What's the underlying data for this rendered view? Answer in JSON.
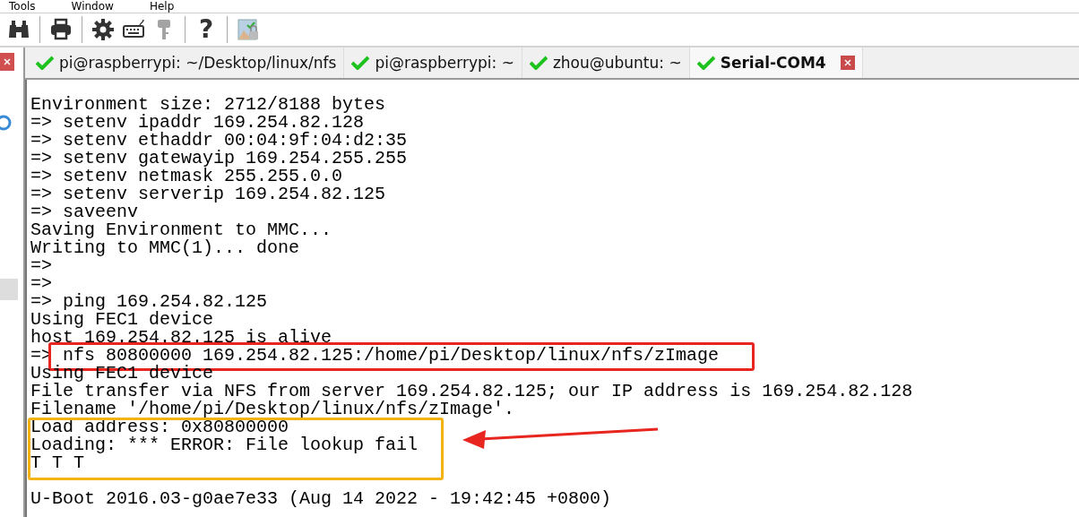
{
  "menu": [
    "Tools",
    "Window",
    "Help"
  ],
  "toolbar": [
    {
      "kind": "binoculars",
      "disabled": false
    },
    {
      "kind": "sep"
    },
    {
      "kind": "printer",
      "disabled": false
    },
    {
      "kind": "sep"
    },
    {
      "kind": "gear",
      "disabled": false
    },
    {
      "kind": "keyboard",
      "disabled": false
    },
    {
      "kind": "key",
      "disabled": true
    },
    {
      "kind": "sep"
    },
    {
      "kind": "help",
      "label": "?",
      "disabled": false
    },
    {
      "kind": "sep"
    },
    {
      "kind": "picture-lock",
      "disabled": false
    }
  ],
  "tabs": [
    {
      "label": "pi@raspberrypi: ~/Desktop/linux/nfs",
      "connected": true,
      "selected": false
    },
    {
      "label": "pi@raspberrypi: ~",
      "connected": true,
      "selected": false
    },
    {
      "label": "zhou@ubuntu: ~",
      "connected": true,
      "selected": false
    },
    {
      "label": "Serial-COM4",
      "connected": true,
      "selected": true
    }
  ],
  "terminal": {
    "blocks": [
      {
        "lines": [
          "Environment size: 2712/8188 bytes",
          "=> setenv ipaddr 169.254.82.128",
          "=> setenv ethaddr 00:04:9f:04:d2:35",
          "=> setenv gatewayip 169.254.255.255",
          "=> setenv netmask 255.255.0.0",
          "=> setenv serverip 169.254.82.125",
          "=> saveenv",
          "Saving Environment to MMC...",
          "Writing to MMC(1)... done",
          "=>",
          "=>",
          "=> ping 169.254.82.125",
          "Using FEC1 device",
          "host 169.254.82.125 is alive"
        ]
      },
      {
        "color": "#e8251f",
        "lines": [
          "=> nfs 80800000 169.254.82.125:/home/pi/Desktop/linux/nfs/zImage"
        ]
      },
      {
        "lines": [
          "Using FEC1 device",
          "File transfer via NFS from server 169.254.82.125; our IP address is 169.254.82.128",
          "Filename '/home/pi/Desktop/linux/nfs/zImage'."
        ]
      },
      {
        "color": "#f5b312",
        "arrow": {
          "color": "#e8251f"
        },
        "lines": [
          "Load address: 0x80800000",
          "Loading: *** ERROR: File lookup fail",
          "T T T"
        ]
      },
      {
        "blank_before": true,
        "lines": [
          "U-Boot 2016.03-g0ae7e33 (Aug 14 2022 - 19:42:45 +0800)"
        ]
      }
    ]
  }
}
